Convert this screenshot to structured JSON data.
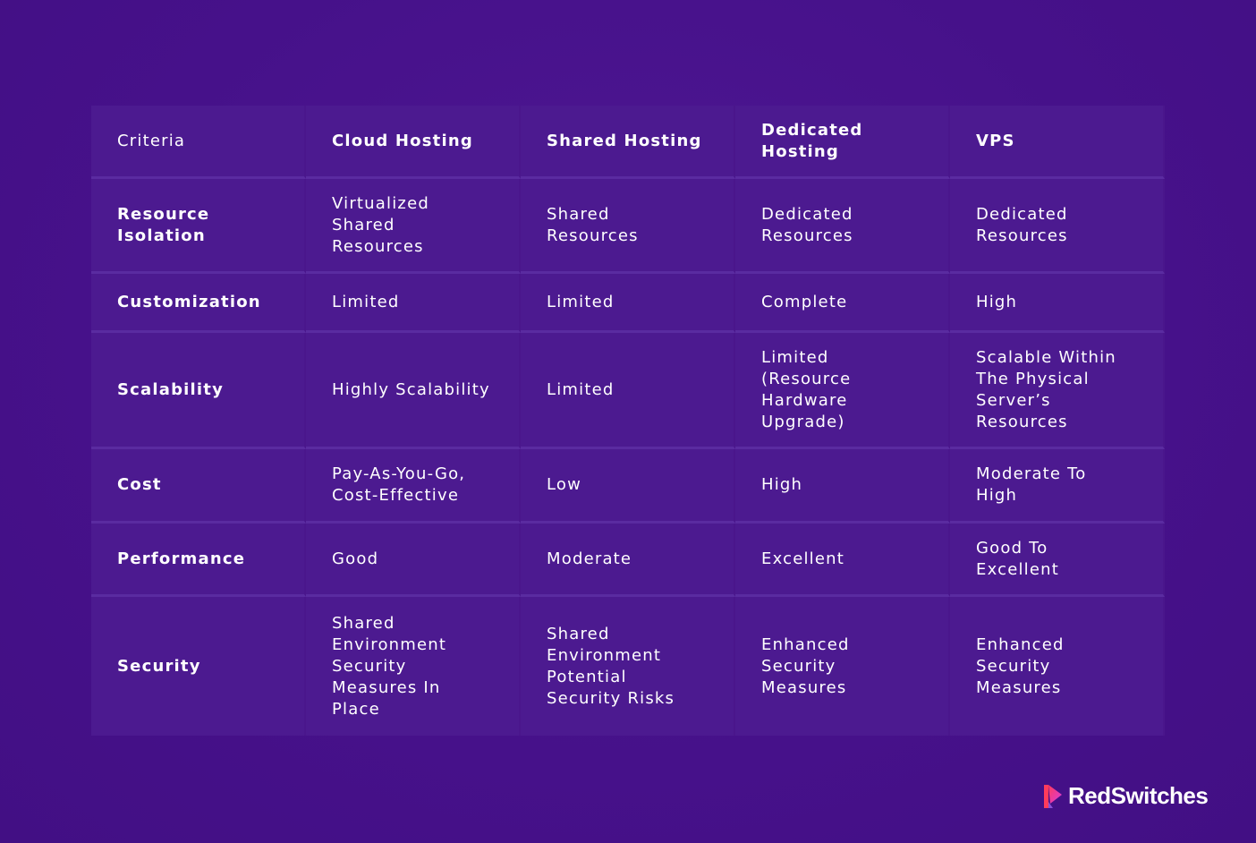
{
  "table": {
    "header": [
      "Criteria",
      "Cloud Hosting",
      "Shared Hosting",
      "Dedicated Hosting",
      "VPS"
    ],
    "rows": [
      [
        "Resource Isolation",
        "Virtualized Shared Resources",
        "Shared Resources",
        "Dedicated Resources",
        "Dedicated Resources"
      ],
      [
        "Customization",
        "Limited",
        "Limited",
        "Complete",
        "High"
      ],
      [
        "Scalability",
        "Highly Scalability",
        "Limited",
        "Limited (Resource Hardware Upgrade)",
        "Scalable Within The Physical Server’s Resources"
      ],
      [
        "Cost",
        "Pay-As-You-Go, Cost-Effective",
        "Low",
        "High",
        "Moderate To High"
      ],
      [
        "Performance",
        "Good",
        "Moderate",
        "Excellent",
        "Good To Excellent"
      ],
      [
        "Security",
        "Shared Environment Security Measures In Place",
        "Shared Environment Potential Security Risks",
        "Enhanced Security Measures",
        "Enhanced Security Measures"
      ]
    ]
  },
  "brand": {
    "name": "RedSwitches",
    "icon": "redswitches-logo-icon",
    "colors": {
      "icon_start": "#ff3b5c",
      "icon_end": "#d63be0"
    }
  }
}
